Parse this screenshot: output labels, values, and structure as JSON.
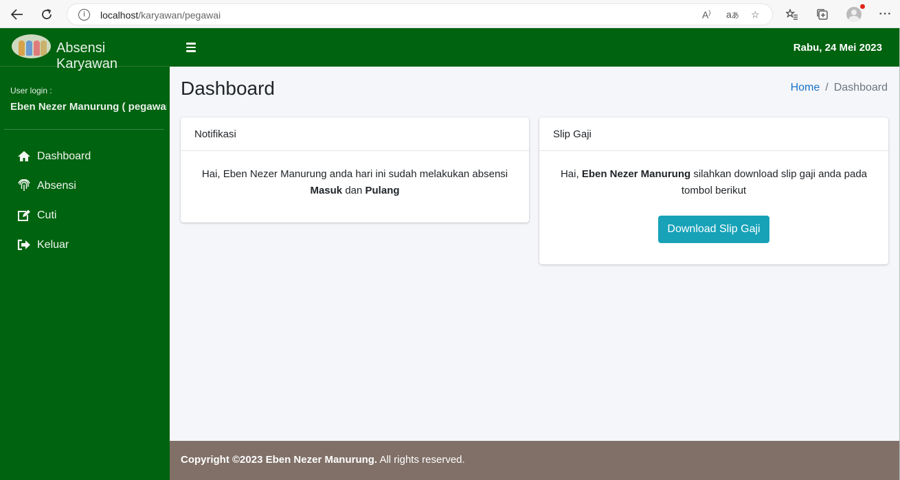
{
  "browser": {
    "url_host": "localhost",
    "url_path": "/karyawan/pegawai"
  },
  "brand": {
    "title": "Absensi Karyawan"
  },
  "user": {
    "label": "User login :",
    "name": "Eben Nezer Manurung ( pegawai )"
  },
  "sidebar": {
    "items": [
      {
        "label": "Dashboard",
        "icon": "home-icon"
      },
      {
        "label": "Absensi",
        "icon": "fingerprint-icon"
      },
      {
        "label": "Cuti",
        "icon": "edit-icon"
      },
      {
        "label": "Keluar",
        "icon": "sign-out-icon"
      }
    ]
  },
  "topbar": {
    "date": "Rabu, 24 Mei 2023"
  },
  "page": {
    "title": "Dashboard"
  },
  "breadcrumb": {
    "home": "Home",
    "separator": "/",
    "current": "Dashboard"
  },
  "notifikasi": {
    "header": "Notifikasi",
    "text1": "Hai, Eben Nezer Manurung anda hari ini sudah melakukan absensi",
    "bold1": "Masuk",
    "conj": "dan",
    "bold2": "Pulang"
  },
  "slip": {
    "header": "Slip Gaji",
    "greet": "Hai,",
    "name": "Eben Nezer Manurung",
    "text": "silahkan download slip gaji anda pada tombol berikut",
    "button": "Download Slip Gaji"
  },
  "footer": {
    "copyright": "Copyright ©2023 Eben Nezer Manurung.",
    "rights": "All rights reserved."
  },
  "colors": {
    "sidebar": "#00630f",
    "button": "#17a2b8",
    "footer": "#807068",
    "link": "#1a73c8"
  }
}
